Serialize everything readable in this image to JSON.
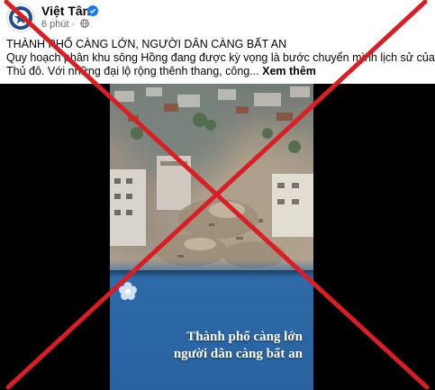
{
  "post": {
    "author": "Việt Tân",
    "time": "6 phút",
    "title": "THÀNH PHỐ CÀNG LỚN, NGƯỜI DÂN CÀNG BẤT AN",
    "body_line1": "Quy hoạch phân khu sông Hồng đang được kỳ vọng là bước chuyển mình lịch sử của",
    "body_line2": "Thủ đô. Với những đại lộ rộng thênh thang, công...",
    "see_more": "Xem thêm"
  },
  "video": {
    "caption_line1": "Thành phố càng lớn",
    "caption_line2": "người dân càng bất an"
  },
  "colors": {
    "cross": "#d81f26",
    "caption_band": "#2b66a4",
    "verified": "#1877f2"
  },
  "icons": [
    "avatar-logo",
    "verified-icon",
    "globe-icon",
    "flower-logo-icon"
  ]
}
